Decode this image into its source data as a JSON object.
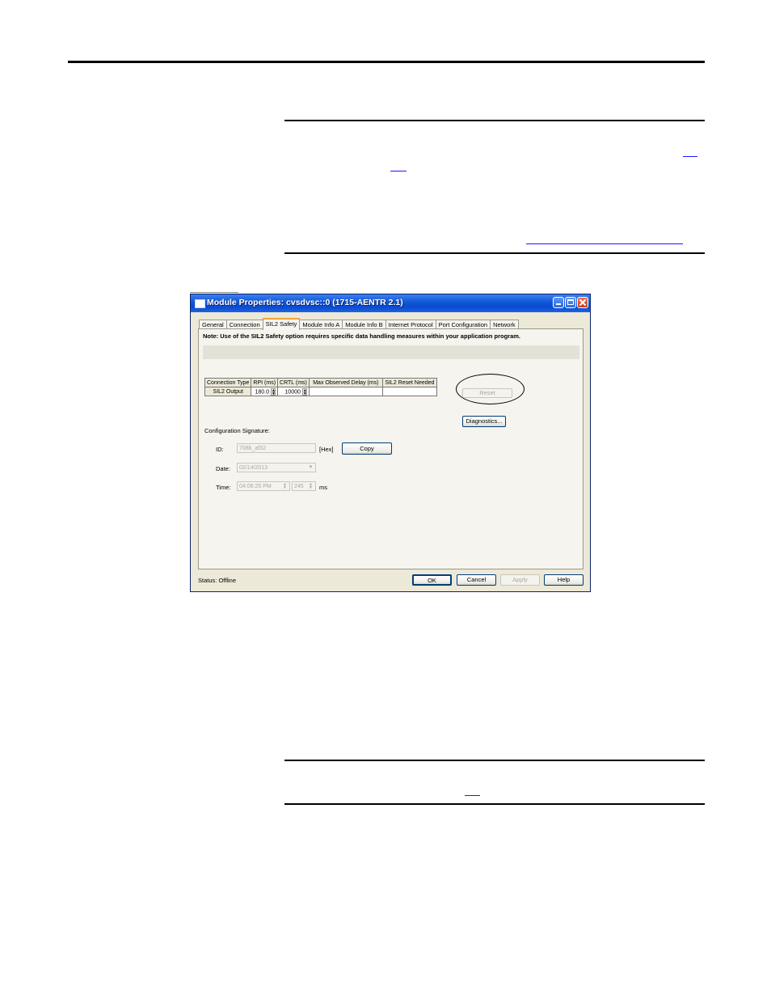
{
  "dialog": {
    "title": "Module Properties: cvsdvsc::0 (1715-AENTR 2.1)",
    "tabs": [
      "General",
      "Connection",
      "SIL2 Safety",
      "Module Info A",
      "Module Info B",
      "Internet Protocol",
      "Port Configuration",
      "Network"
    ],
    "active_tab": "SIL2 Safety",
    "note": "Note: Use of the SIL2 Safety option requires specific data handling measures within your application program.",
    "table": {
      "headers": [
        "Connection Type",
        "RPI (ms)",
        "CRTL (ms)",
        "Max Observed Delay (ms)",
        "SIL2 Reset Needed"
      ],
      "row": {
        "connection_type": "SIL2 Output",
        "rpi": "180.0",
        "crtl": "10000",
        "max_observed_delay": "",
        "reset_needed": ""
      }
    },
    "reset_button": "Reset",
    "diagnostics_button": "Diagnostics...",
    "config_signature_label": "Configuration Signature:",
    "id_label": "ID:",
    "id_value": "708b_af32",
    "hex_label": "[Hex]",
    "copy_button": "Copy",
    "date_label": "Date:",
    "date_value": "02/14/2013",
    "time_label": "Time:",
    "time_value": "04:06:25 PM",
    "ms_value": "245",
    "ms_label": "ms",
    "status_label": "Status:",
    "status_value": "Offline",
    "buttons": {
      "ok": "OK",
      "cancel": "Cancel",
      "apply": "Apply",
      "help": "Help"
    }
  }
}
